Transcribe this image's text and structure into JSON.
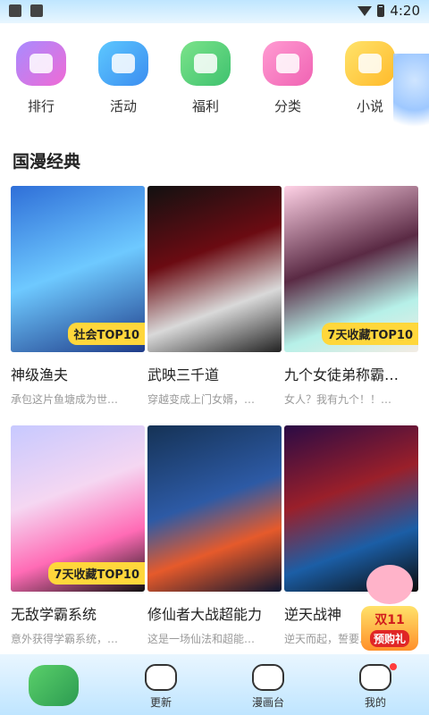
{
  "status": {
    "time": "4:20"
  },
  "nav": {
    "items": [
      {
        "label": "排行",
        "icon": "ranking-icon"
      },
      {
        "label": "活动",
        "icon": "activity-icon"
      },
      {
        "label": "福利",
        "icon": "gift-icon"
      },
      {
        "label": "分类",
        "icon": "category-icon"
      },
      {
        "label": "小说",
        "icon": "novel-icon"
      },
      {
        "label": "",
        "icon": "sign-in-icon"
      }
    ]
  },
  "section": {
    "title": "国漫经典"
  },
  "comics": [
    {
      "title": "神级渔夫",
      "desc": "承包这片鱼塘成为世…",
      "badge": "社会TOP10"
    },
    {
      "title": "武映三千道",
      "desc": "穿越变成上门女婿，…",
      "badge": ""
    },
    {
      "title": "九个女徒弟称霸…",
      "desc": "女人？我有九个！！…",
      "badge": "7天收藏TOP10"
    },
    {
      "title": "无敌学霸系统",
      "desc": "意外获得学霸系统，…",
      "badge": "7天收藏TOP10"
    },
    {
      "title": "修仙者大战超能力",
      "desc": "这是一场仙法和超能…",
      "badge": ""
    },
    {
      "title": "逆天战神",
      "desc": "逆天而起，誓要…",
      "badge": ""
    }
  ],
  "promo": {
    "line1": "双11",
    "line2": "预购礼"
  },
  "tabbar": {
    "items": [
      {
        "label": "",
        "icon": "home-icon"
      },
      {
        "label": "更新",
        "icon": "update-icon"
      },
      {
        "label": "漫画台",
        "icon": "comic-stage-icon"
      },
      {
        "label": "我的",
        "icon": "profile-icon"
      }
    ]
  }
}
